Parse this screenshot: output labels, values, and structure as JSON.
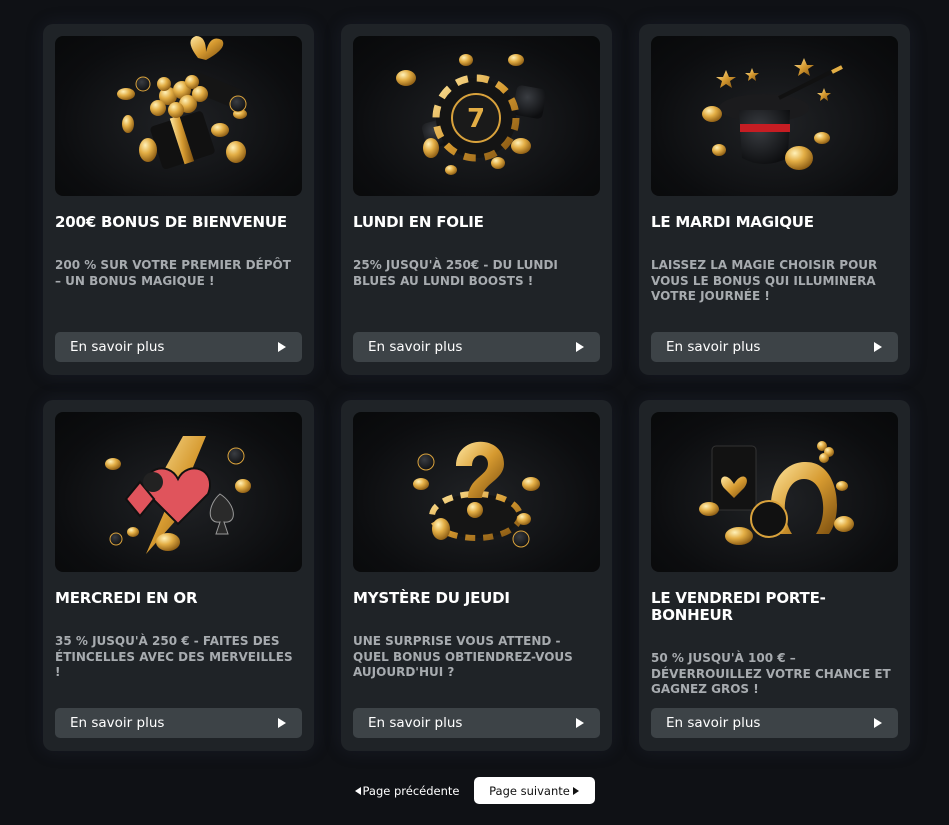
{
  "colors": {
    "background": "#0f1115",
    "card": "#1f2327",
    "button": "#3d4347",
    "gold": "#d9a23c",
    "description": "#a7abaf"
  },
  "cards": [
    {
      "title": "200€ BONUS DE BIENVENUE",
      "description": "200 % SUR VOTRE PREMIER DÉPÔT – UN BONUS MAGIQUE !",
      "button_label": "En savoir plus",
      "image": "gift-box-coins-icon"
    },
    {
      "title": "LUNDI EN FOLIE",
      "description": "25% JUSQU'À 250€ - DU LUNDI BLUES AU LUNDI BOOSTS !",
      "button_label": "En savoir plus",
      "image": "casino-chip-dice-icon"
    },
    {
      "title": "LE MARDI MAGIQUE",
      "description": "LAISSEZ LA MAGIE CHOISIR POUR VOUS LE BONUS QUI ILLUMINERA VOTRE JOURNÉE !",
      "button_label": "En savoir plus",
      "image": "magic-hat-wand-icon"
    },
    {
      "title": "MERCREDI EN OR",
      "description": "35 % JUSQU'À 250 € - FAITES DES ÉTINCELLES AVEC DES MERVEILLES !",
      "button_label": "En savoir plus",
      "image": "card-suits-lightning-icon"
    },
    {
      "title": "MYSTÈRE DU JEUDI",
      "description": "UNE SURPRISE VOUS ATTEND - QUEL BONUS OBTIENDREZ-VOUS AUJOURD'HUI ?",
      "button_label": "En savoir plus",
      "image": "question-mark-chip-icon"
    },
    {
      "title": "LE VENDREDI PORTE-BONHEUR",
      "description": "50 % JUSQU'À 100 € – DÉVERROUILLEZ VOTRE CHANCE ET GAGNEZ GROS !",
      "button_label": "En savoir plus",
      "image": "horseshoe-ace-icon"
    }
  ],
  "pagination": {
    "prev_label": "Page précédente",
    "next_label": "Page suivante"
  }
}
